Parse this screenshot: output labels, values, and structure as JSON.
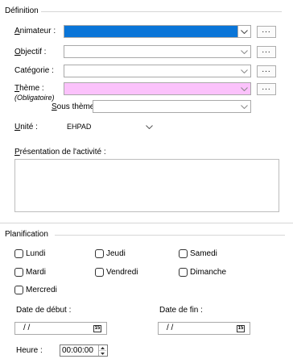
{
  "definition": {
    "section_title": "Définition",
    "animateur_label": "Animateur :",
    "objectif_label": "Objectif :",
    "categorie_label": "Catégorie :",
    "theme_label": "Thème :",
    "theme_required": "(Obligatoire)",
    "sous_theme_label": "Sous thème :",
    "unite_label": "Unité :",
    "unite_value": "EHPAD",
    "presentation_label": "Présentation de l'activité :",
    "dots": "...",
    "colors": {
      "animateur_fill": "#0a75d8",
      "theme_fill": "#fbc2fb"
    }
  },
  "planification": {
    "section_title": "Planification",
    "days": {
      "lundi": "Lundi",
      "jeudi": "Jeudi",
      "samedi": "Samedi",
      "mardi": "Mardi",
      "vendredi": "Vendredi",
      "dimanche": "Dimanche",
      "mercredi": "Mercredi"
    },
    "date_debut_label": "Date de début :",
    "date_debut_value": "/ /",
    "date_fin_label": "Date de fin :",
    "date_fin_value": "/ /",
    "calendar_icon_text": "15",
    "heure_label": "Heure :",
    "heure_value": "00:00:00"
  }
}
